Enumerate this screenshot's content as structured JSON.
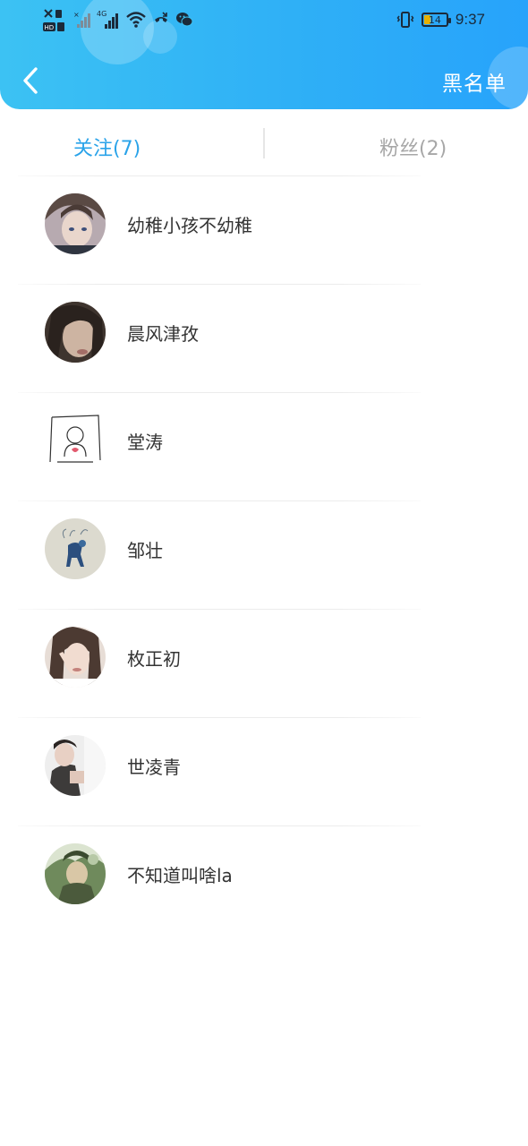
{
  "status_bar": {
    "network": "4G",
    "battery": "14",
    "time": "9:37"
  },
  "header": {
    "back_icon": "chevron-left-icon",
    "blacklist_label": "黑名单",
    "gradient_start": "#3cc2f3",
    "gradient_end": "#27a3fb"
  },
  "tabs": {
    "following_label": "关注(7)",
    "fans_label": "粉丝(2)",
    "active_color": "#2aa3e9",
    "inactive_color": "#a7a7a7"
  },
  "following": [
    {
      "name": "幼稚小孩不幼稚"
    },
    {
      "name": "晨风津孜"
    },
    {
      "name": "堂涛"
    },
    {
      "name": "邹壮"
    },
    {
      "name": "枚正初"
    },
    {
      "name": "世凌青"
    },
    {
      "name": "不知道叫啥la"
    }
  ]
}
